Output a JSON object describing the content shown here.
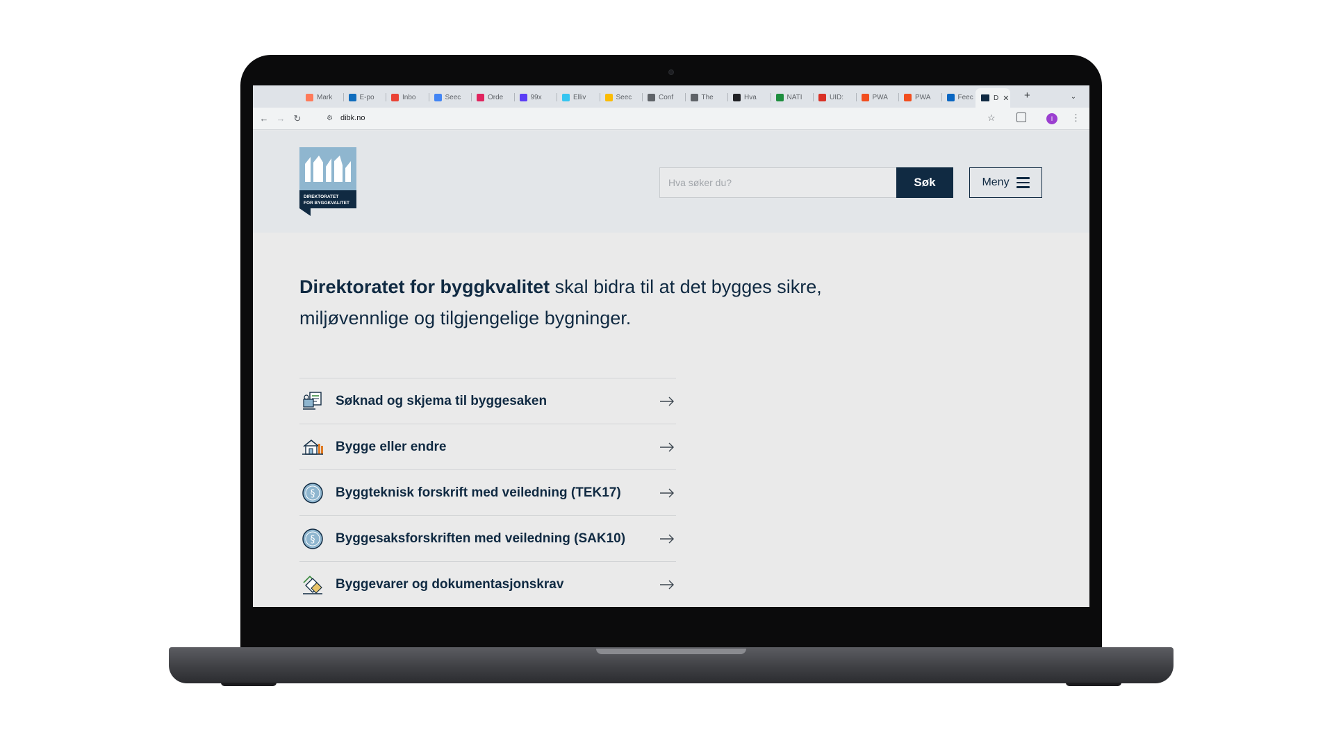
{
  "browser": {
    "tabs": [
      {
        "label": "Mark",
        "color": "#ff7a59"
      },
      {
        "label": "E-po",
        "color": "#0f6cbd"
      },
      {
        "label": "Inbo",
        "color": "#ea4335"
      },
      {
        "label": "Seec",
        "color": "#4285f4"
      },
      {
        "label": "Orde",
        "color": "#e0245e"
      },
      {
        "label": "99x",
        "color": "#5b3df5"
      },
      {
        "label": "Elliv",
        "color": "#36c5f0"
      },
      {
        "label": "Seec",
        "color": "#fbbc04"
      },
      {
        "label": "Conf",
        "color": "#5f6368"
      },
      {
        "label": "The",
        "color": "#5f6368"
      },
      {
        "label": "Hva",
        "color": "#202124"
      },
      {
        "label": "NATI",
        "color": "#1e8e3e"
      },
      {
        "label": "UID:",
        "color": "#d93025"
      },
      {
        "label": "PWA",
        "color": "#f24e1e"
      },
      {
        "label": "PWA",
        "color": "#f24e1e"
      },
      {
        "label": "Feec",
        "color": "#0a66c2"
      }
    ],
    "active_tab": {
      "label": "D",
      "color": "#102a42"
    },
    "url": "dibk.no",
    "profile_initial": "I"
  },
  "header": {
    "logo_text": [
      "DIREKTORATET",
      "FOR BYGGKVALITET"
    ],
    "search_placeholder": "Hva søker du?",
    "search_button": "Søk",
    "menu_button": "Meny"
  },
  "intro": {
    "strong": "Direktoratet for byggkvalitet",
    "text": " skal bidra til at det bygges sikre, miljøvennlige og tilgjengelige bygninger."
  },
  "links": [
    {
      "label": "Søknad og skjema til byggesaken",
      "icon": "application-form-icon"
    },
    {
      "label": "Bygge eller endre",
      "icon": "house-icon"
    },
    {
      "label": "Byggteknisk forskrift med veiledning (TEK17)",
      "icon": "paragraph-icon"
    },
    {
      "label": "Byggesaksforskriften med veiledning (SAK10)",
      "icon": "paragraph-icon"
    },
    {
      "label": "Byggevarer og dokumentasjonskrav",
      "icon": "building-products-icon"
    }
  ]
}
